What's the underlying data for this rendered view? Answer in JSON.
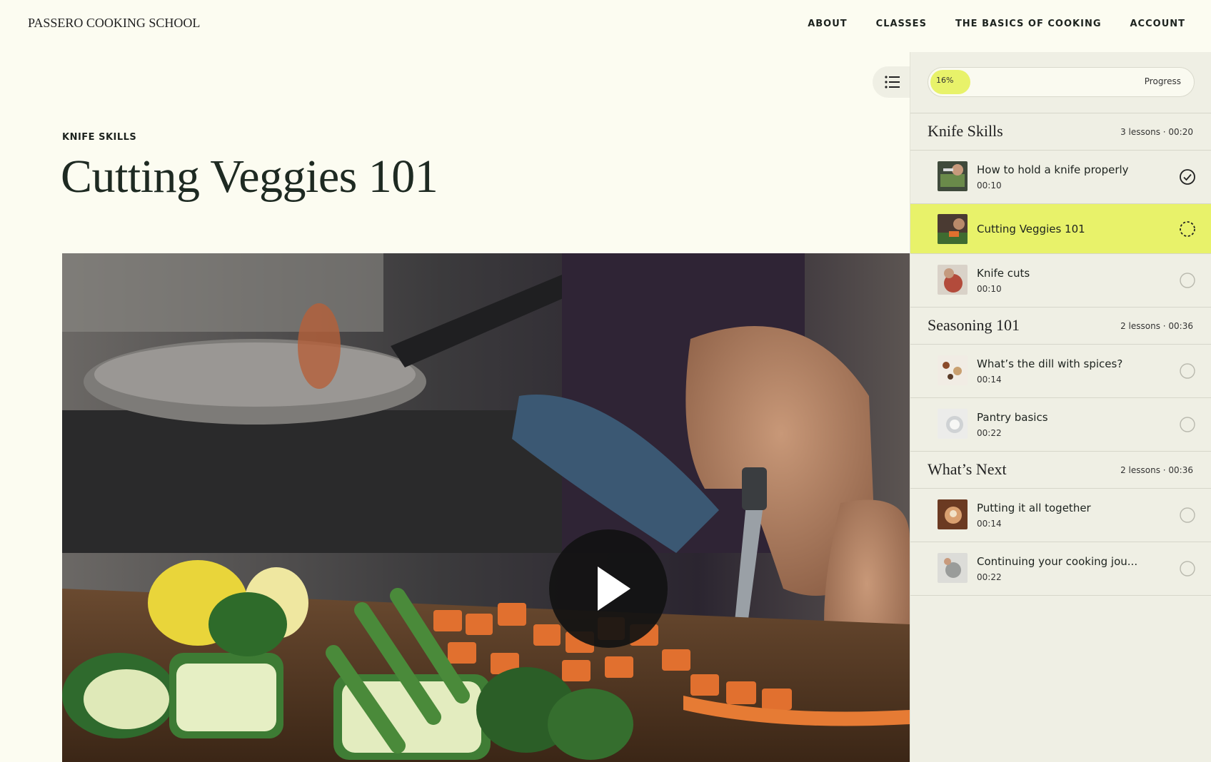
{
  "header": {
    "logo": "PASSERO COOKING SCHOOL",
    "nav": [
      {
        "label": "ABOUT"
      },
      {
        "label": "CLASSES"
      },
      {
        "label": "THE BASICS OF COOKING"
      },
      {
        "label": "ACCOUNT"
      }
    ]
  },
  "main": {
    "eyebrow": "KNIFE SKILLS",
    "title": "Cutting Veggies 101",
    "video": {
      "play_icon": "play-icon"
    }
  },
  "sidebar": {
    "toggle_icon": "list-icon",
    "progress": {
      "percent_label": "16%",
      "label": "Progress",
      "value": 0.16
    },
    "sections": [
      {
        "title": "Knife Skills",
        "meta": "3 lessons · 00:20",
        "lessons": [
          {
            "title": "How to hold a knife properly",
            "time": "00:10",
            "status": "completed"
          },
          {
            "title": "Cutting Veggies 101",
            "time": "",
            "status": "in-progress"
          },
          {
            "title": "Knife cuts",
            "time": "00:10",
            "status": "not-started"
          }
        ]
      },
      {
        "title": "Seasoning 101",
        "meta": "2 lessons · 00:36",
        "lessons": [
          {
            "title": "What’s the dill with spices?",
            "time": "00:14",
            "status": "not-started"
          },
          {
            "title": "Pantry basics",
            "time": "00:22",
            "status": "not-started"
          }
        ]
      },
      {
        "title": "What’s Next",
        "meta": "2 lessons · 00:36",
        "lessons": [
          {
            "title": "Putting it all together",
            "time": "00:14",
            "status": "not-started"
          },
          {
            "title": "Continuing your cooking jou...",
            "time": "00:22",
            "status": "not-started"
          }
        ]
      }
    ]
  },
  "colors": {
    "background": "#fcfcf1",
    "sidebar": "#efefe4",
    "accent": "#e8f26a",
    "text": "#1d231f"
  }
}
